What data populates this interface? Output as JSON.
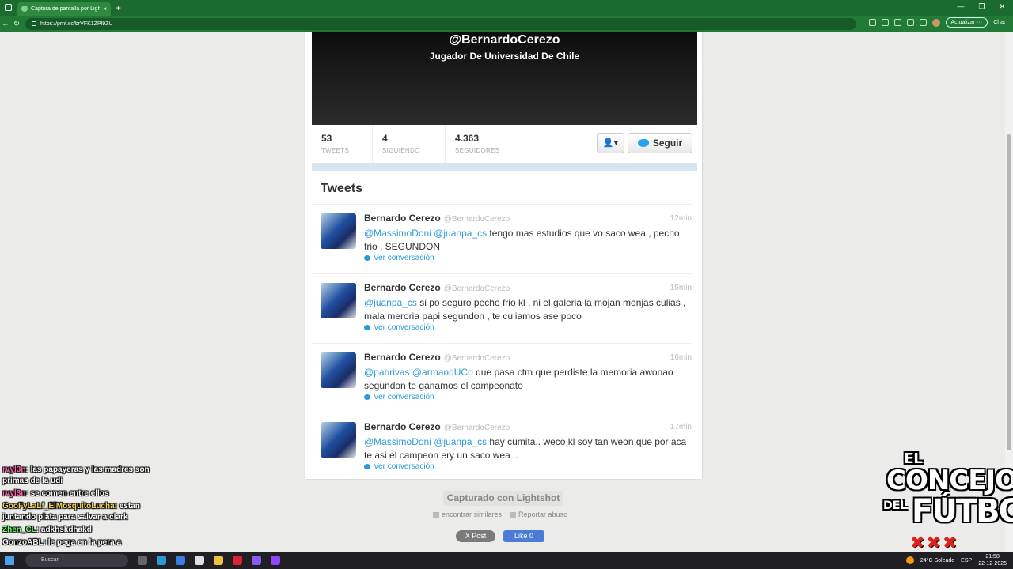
{
  "browser": {
    "tab_title": "Captura de pantalla por Lightshot",
    "tab_close": "×",
    "new_tab": "+",
    "url": "https://prnt.sc/brVFK1ZPl9ZU",
    "update_label": "Actualizar ···",
    "chat_label": "Chat"
  },
  "profile": {
    "handle": "@BernardoCerezo",
    "bio": "Jugador De Universidad De Chile",
    "stats": [
      {
        "num": "53",
        "label": "TWEETS"
      },
      {
        "num": "4",
        "label": "SIGUIENDO"
      },
      {
        "num": "4.363",
        "label": "SEGUIDORES"
      }
    ],
    "person_menu": "👤▾",
    "follow_label": "Seguir"
  },
  "tweets_heading": "Tweets",
  "tweets": [
    {
      "name": "Bernardo Cerezo",
      "user": "@BernardoCerezo",
      "time": "12min",
      "mentions": "@MassimoDoni @juanpa_cs",
      "text": " tengo mas estudios que vo saco wea , pecho frio , SEGUNDON",
      "conv": "Ver conversación"
    },
    {
      "name": "Bernardo Cerezo",
      "user": "@BernardoCerezo",
      "time": "15min",
      "mentions": "@juanpa_cs",
      "text": " si po seguro pecho frio kl , ni el galeria la mojan monjas culias , mala meroria papi segundon , te culiamos ase poco",
      "conv": "Ver conversación"
    },
    {
      "name": "Bernardo Cerezo",
      "user": "@BernardoCerezo",
      "time": "16min",
      "mentions": "@pabrivas @armandUCo",
      "text": " que pasa ctm que perdiste la memoria awonao segundon te ganamos el campeonato",
      "conv": "Ver conversación"
    },
    {
      "name": "Bernardo Cerezo",
      "user": "@BernardoCerezo",
      "time": "17min",
      "mentions": "@MassimoDoni @juanpa_cs",
      "text": " hay cumita.. weco kl soy tan weon que por aca te asi el campeon ery un saco wea ..",
      "conv": "Ver conversación"
    }
  ],
  "lightshot": {
    "captured": "Capturado con Lightshot",
    "similar": "encontrar similares",
    "report": "Reportar abuso",
    "post": "X Post",
    "like": "Like 0"
  },
  "chat": [
    {
      "user": "rvyl3n",
      "msg": ": las papayeras y las madres son primas de la udi"
    },
    {
      "user": "rvyl3n",
      "msg": ": se comen entre ellos"
    },
    {
      "user": "GooFyLaLf_ElMosquitoLucha",
      "msg": ": estan juntando plata para salvar a clark"
    },
    {
      "user": "Zhen_CL",
      "msg": ": adkhskdhakd"
    },
    {
      "user": "GonzoABL",
      "msg": ": le pega en la pera a"
    }
  ],
  "logo": {
    "line1": "EL",
    "line2": "CONCEJO",
    "line3": "DEL",
    "line4": "FÚTBOL",
    "marks": "✖✖✖"
  },
  "taskbar": {
    "search": "Buscar",
    "weather": "24°C  Soleado",
    "lang": "ESP",
    "time": "21:58",
    "date": "22-12-2025"
  },
  "colors": {
    "accent": "#2a9bd8",
    "browser_green": "#217a36"
  }
}
